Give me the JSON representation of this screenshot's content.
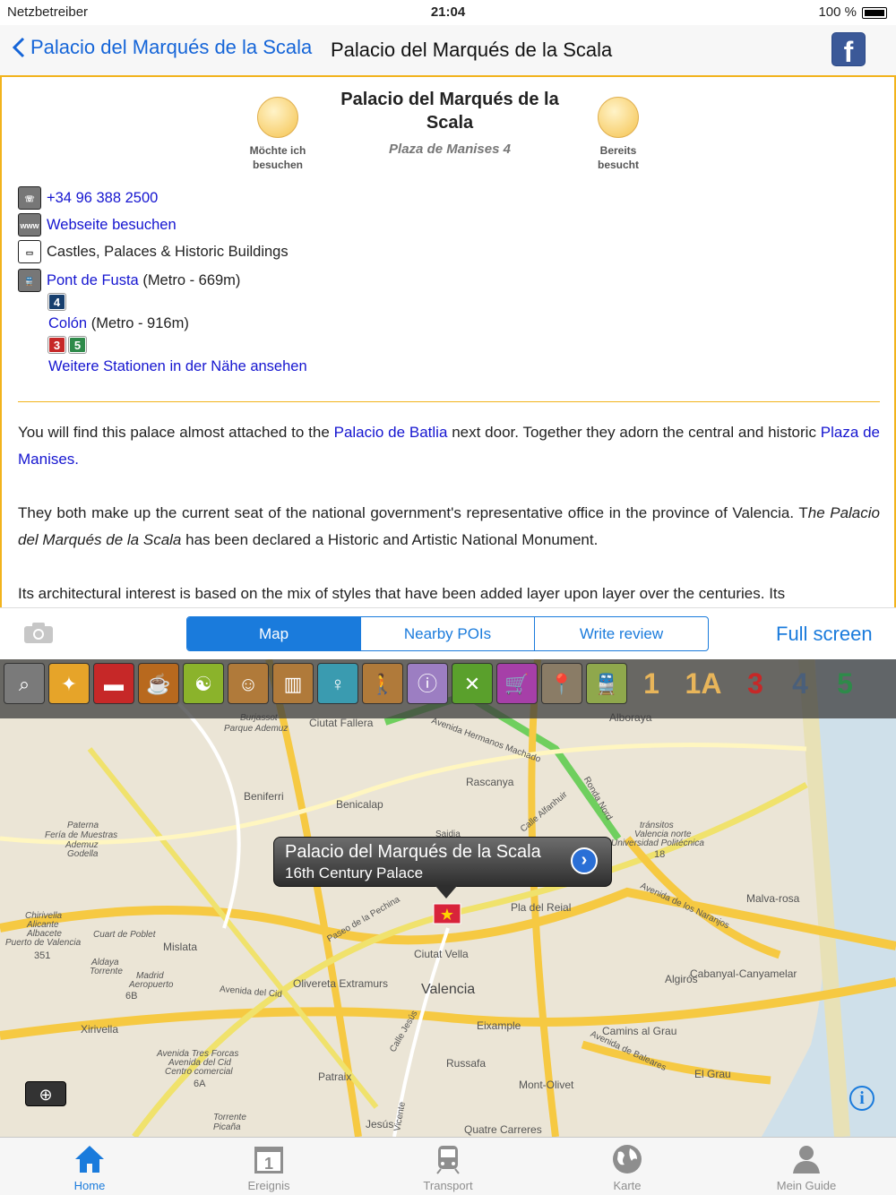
{
  "status": {
    "carrier": "Netzbetreiber",
    "time": "21:04",
    "battery": "100 %"
  },
  "nav": {
    "back_label": "Palacio del Marqués de la Scala",
    "title": "Palacio del Marqués de la Scala",
    "facebook_icon": "facebook-icon"
  },
  "header": {
    "title": "Palacio del Marqués de la Scala",
    "address": "Plaza de Manises 4",
    "wish_label": "Möchte ich besuchen",
    "visited_label": "Bereits besucht"
  },
  "details": {
    "phone": "+34 96 388 2500",
    "website": "Webseite besuchen",
    "category": "Castles, Palaces & Historic Buildings",
    "station1_name": "Pont de Fusta",
    "station1_info": " (Metro - 669m)",
    "station1_lines": [
      "4"
    ],
    "station2_name": "Colón",
    "station2_info": " (Metro - 916m)",
    "station2_lines": [
      "3",
      "5"
    ],
    "more_stations": "Weitere Stationen in der Nähe ansehen"
  },
  "description": {
    "p1_a": "You will find this palace almost attached to the ",
    "p1_link1": "Palacio de Batlia",
    "p1_b": " next door. Together they adorn the central and historic ",
    "p1_link2": "Plaza de Manises.",
    "p2_a": "They both make up the current seat of the national government's representative office in the province of Valencia. T",
    "p2_b": "he Palacio del Marqués de la Scala",
    "p2_c": " has been declared a Historic and Artistic National Monument.",
    "p3": "Its architectural interest is based on the mix of styles that have been added layer upon layer over the centuries. Its"
  },
  "segment": {
    "tabs": [
      "Map",
      "Nearby POIs",
      "Write review"
    ],
    "selected": "Map",
    "fullscreen": "Full screen"
  },
  "map": {
    "poi_icons": [
      {
        "name": "search-icon",
        "glyph": "⌕",
        "color": "#7a7a7a"
      },
      {
        "name": "nightlife-icon",
        "glyph": "✦",
        "color": "#e6a429"
      },
      {
        "name": "hotel-icon",
        "glyph": "▬",
        "color": "#c62828"
      },
      {
        "name": "cafe-icon",
        "glyph": "☕",
        "color": "#b8691e"
      },
      {
        "name": "wellness-icon",
        "glyph": "☯",
        "color": "#8bb32b"
      },
      {
        "name": "theater-icon",
        "glyph": "☺",
        "color": "#b07a3a"
      },
      {
        "name": "museum-icon",
        "glyph": "▥",
        "color": "#b07a3a"
      },
      {
        "name": "adult-icon",
        "glyph": "♀",
        "color": "#3a9bb0"
      },
      {
        "name": "hiking-icon",
        "glyph": "🚶",
        "color": "#b07a3a"
      },
      {
        "name": "info-icon",
        "glyph": "ⓘ",
        "color": "#9c7ec2"
      },
      {
        "name": "restaurant-icon",
        "glyph": "✕",
        "color": "#5aa02c"
      },
      {
        "name": "shopping-icon",
        "glyph": "🛒",
        "color": "#a63fa8"
      },
      {
        "name": "sight-icon",
        "glyph": "📍",
        "color": "#8a7c66"
      },
      {
        "name": "transport-icon",
        "glyph": "🚆",
        "color": "#8fa84c"
      }
    ],
    "line_buttons": [
      {
        "label": "1",
        "color": "#e8b55a"
      },
      {
        "label": "1A",
        "color": "#e8b55a"
      },
      {
        "label": "3",
        "color": "#c62828"
      },
      {
        "label": "4",
        "color": "#4a5f7a"
      },
      {
        "label": "5",
        "color": "#2e8a4a"
      }
    ],
    "callout_title": "Palacio del Marqués de la Scala",
    "callout_subtitle": "16th Century Palace",
    "labels": [
      {
        "text": "Ciutat Fallera"
      },
      {
        "text": "Rascanya"
      },
      {
        "text": "Benicalap"
      },
      {
        "text": "Beniferri"
      },
      {
        "text": "Malva-rosa"
      },
      {
        "text": "Pla del Reial"
      },
      {
        "text": "Ciutat Vella"
      },
      {
        "text": "Valencia"
      },
      {
        "text": "Olivereta Extramurs"
      },
      {
        "text": "Mislata"
      },
      {
        "text": "Algirós"
      },
      {
        "text": "Cabanyal-Canyamelar"
      },
      {
        "text": "Eixample"
      },
      {
        "text": "Camins al Grau"
      },
      {
        "text": "Russafa"
      },
      {
        "text": "Xirivella"
      },
      {
        "text": "Patraix"
      },
      {
        "text": "Mont-Olivet"
      },
      {
        "text": "El Grau"
      },
      {
        "text": "Quatre Carreres"
      },
      {
        "text": "Jesús"
      },
      {
        "text": "Alboraya"
      },
      {
        "text": "Burjassot"
      },
      {
        "text": "Parque Ademuz"
      },
      {
        "text": "Paterna"
      },
      {
        "text": "Fería de Muestras"
      },
      {
        "text": "Ademuz"
      },
      {
        "text": "Godella"
      },
      {
        "text": "Chirivella"
      },
      {
        "text": "Alicante"
      },
      {
        "text": "Albacete"
      },
      {
        "text": "Puerto de Valencia"
      },
      {
        "text": "Cuart de Poblet"
      },
      {
        "text": "Aldaya"
      },
      {
        "text": "Torrente"
      },
      {
        "text": "Madrid"
      },
      {
        "text": "Aeropuerto"
      },
      {
        "text": "Avenida Tres Forcas"
      },
      {
        "text": "Avenida del Cid"
      },
      {
        "text": "Centro comercial"
      },
      {
        "text": "Torrente Picaña"
      },
      {
        "text": "Valencia norte"
      },
      {
        "text": "Universidad Politécnica"
      },
      {
        "text": "tránsitos"
      },
      {
        "text": "Avenida de los Naranjos"
      },
      {
        "text": "Avenida de Baleares"
      },
      {
        "text": "Paseo de la Pechina"
      },
      {
        "text": "Avenida Hermanos Machado"
      },
      {
        "text": "Calle Alfanhuir"
      },
      {
        "text": "Ronda Nord"
      },
      {
        "text": "Calle Jesús"
      },
      {
        "text": "Vicente"
      },
      {
        "text": "Avenida del Cid"
      },
      {
        "text": "Saidia"
      },
      {
        "text": "351"
      },
      {
        "text": "6B"
      },
      {
        "text": "6A"
      },
      {
        "text": "18"
      }
    ]
  },
  "tabbar": {
    "items": [
      {
        "label": "Home",
        "icon": "home-icon"
      },
      {
        "label": "Ereignis",
        "icon": "calendar-icon"
      },
      {
        "label": "Transport",
        "icon": "train-icon"
      },
      {
        "label": "Karte",
        "icon": "globe-icon"
      },
      {
        "label": "Mein Guide",
        "icon": "person-icon"
      }
    ],
    "selected": "Home"
  }
}
